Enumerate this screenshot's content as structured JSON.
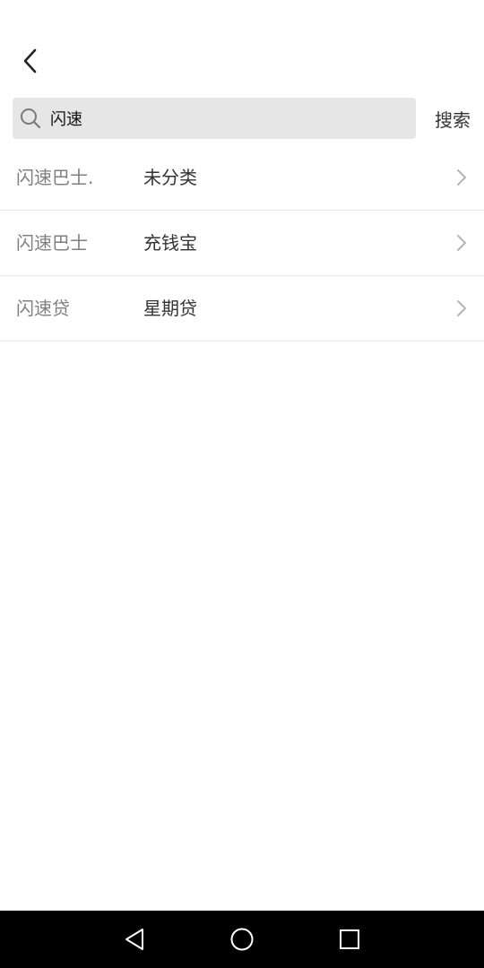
{
  "header": {
    "back_icon": "chevron-left-icon"
  },
  "search": {
    "value": "闪速",
    "placeholder": "",
    "icon": "search-icon",
    "button_label": "搜索"
  },
  "results": [
    {
      "name": "闪速巴士.",
      "category": "未分类"
    },
    {
      "name": "闪速巴士",
      "category": "充钱宝"
    },
    {
      "name": "闪速贷",
      "category": "星期贷"
    }
  ],
  "nav": {
    "back_icon": "triangle-back-icon",
    "home_icon": "circle-home-icon",
    "recents_icon": "square-recents-icon"
  },
  "colors": {
    "search_bg": "#e6e6e6",
    "name_text": "#808080",
    "category_text": "#333333",
    "divider": "#e8e8e8",
    "nav_bg": "#000000"
  }
}
